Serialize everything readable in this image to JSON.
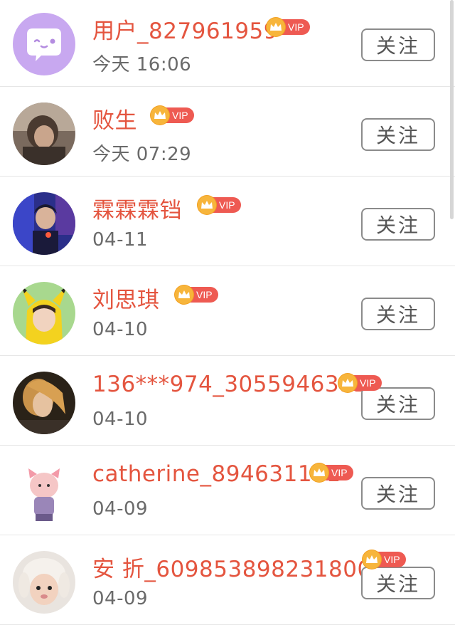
{
  "follow_label": "关注",
  "vip_label": "VIP",
  "users": [
    {
      "name": "用户_827961959",
      "time": "今天 16:06",
      "avatar": "chat-bubble-icon"
    },
    {
      "name": "败生",
      "time": "今天 07:29",
      "avatar": "photo"
    },
    {
      "name": "霖霖霖铛",
      "time": "04-11",
      "avatar": "photo"
    },
    {
      "name": "刘思琪",
      "time": "04-10",
      "avatar": "photo"
    },
    {
      "name": "136***974_3055946392",
      "time": "04-10",
      "avatar": "photo"
    },
    {
      "name": "catherine_894631141",
      "time": "04-09",
      "avatar": "photo"
    },
    {
      "name": "安 折_6098538982318000",
      "time": "04-09",
      "avatar": "photo"
    }
  ],
  "colors": {
    "name": "#e4553f",
    "vip_tag": "#ee5a52",
    "crown": "#f7b53b",
    "chat_avatar_bg": "#c8a8f0"
  }
}
